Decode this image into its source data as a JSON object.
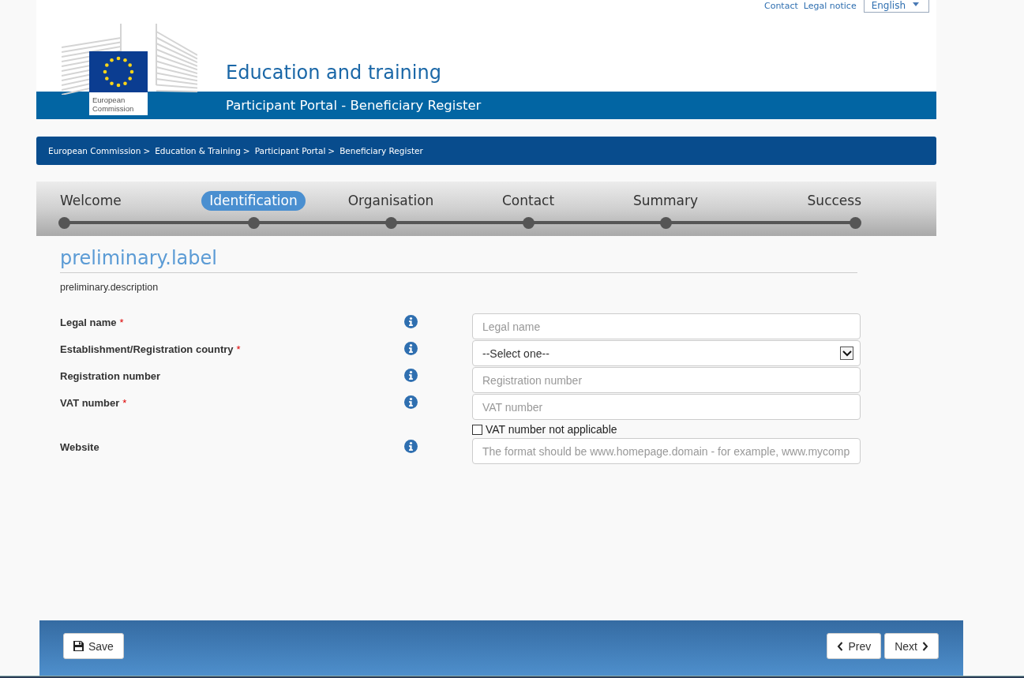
{
  "top_links": [
    {
      "label": "Contact"
    },
    {
      "label": "Legal notice"
    }
  ],
  "language": {
    "value": "English"
  },
  "logo": {
    "caption": "European Commission"
  },
  "header": {
    "title": "Education and training",
    "subtitle": "Participant Portal - Beneficiary Register"
  },
  "breadcrumb": [
    {
      "label": "European Commission",
      "separator": ">"
    },
    {
      "label": "Education & Training",
      "separator": ">"
    },
    {
      "label": "Participant Portal",
      "separator": ">"
    },
    {
      "label": "Beneficiary Register"
    }
  ],
  "steps": [
    {
      "label": "Welcome",
      "selected": false
    },
    {
      "label": "Identification",
      "selected": true
    },
    {
      "label": "Organisation",
      "selected": false
    },
    {
      "label": "Contact",
      "selected": false
    },
    {
      "label": "Summary",
      "selected": false
    },
    {
      "label": "Success",
      "selected": false
    }
  ],
  "section": {
    "title": "preliminary.label",
    "description": "preliminary.description"
  },
  "fields": [
    {
      "kind": "input",
      "label": "Legal name",
      "required_mark": "*",
      "placeholder": "Legal name"
    },
    {
      "kind": "select",
      "label": "Establishment/Registration country",
      "required_mark": "*",
      "value": "--Select one--"
    },
    {
      "kind": "input",
      "label": "Registration number",
      "placeholder": "Registration number"
    },
    {
      "kind": "input",
      "label": "VAT number",
      "required_mark": "*",
      "placeholder": "VAT number"
    },
    {
      "kind": "checkbox",
      "label": "VAT number not applicable",
      "checked": false
    },
    {
      "kind": "input",
      "label": "Website",
      "placeholder": "The format should be www.homepage.domain - for example, www.mycomp"
    }
  ],
  "footer": {
    "save": "Save",
    "prev": "Prev",
    "next": "Next"
  }
}
